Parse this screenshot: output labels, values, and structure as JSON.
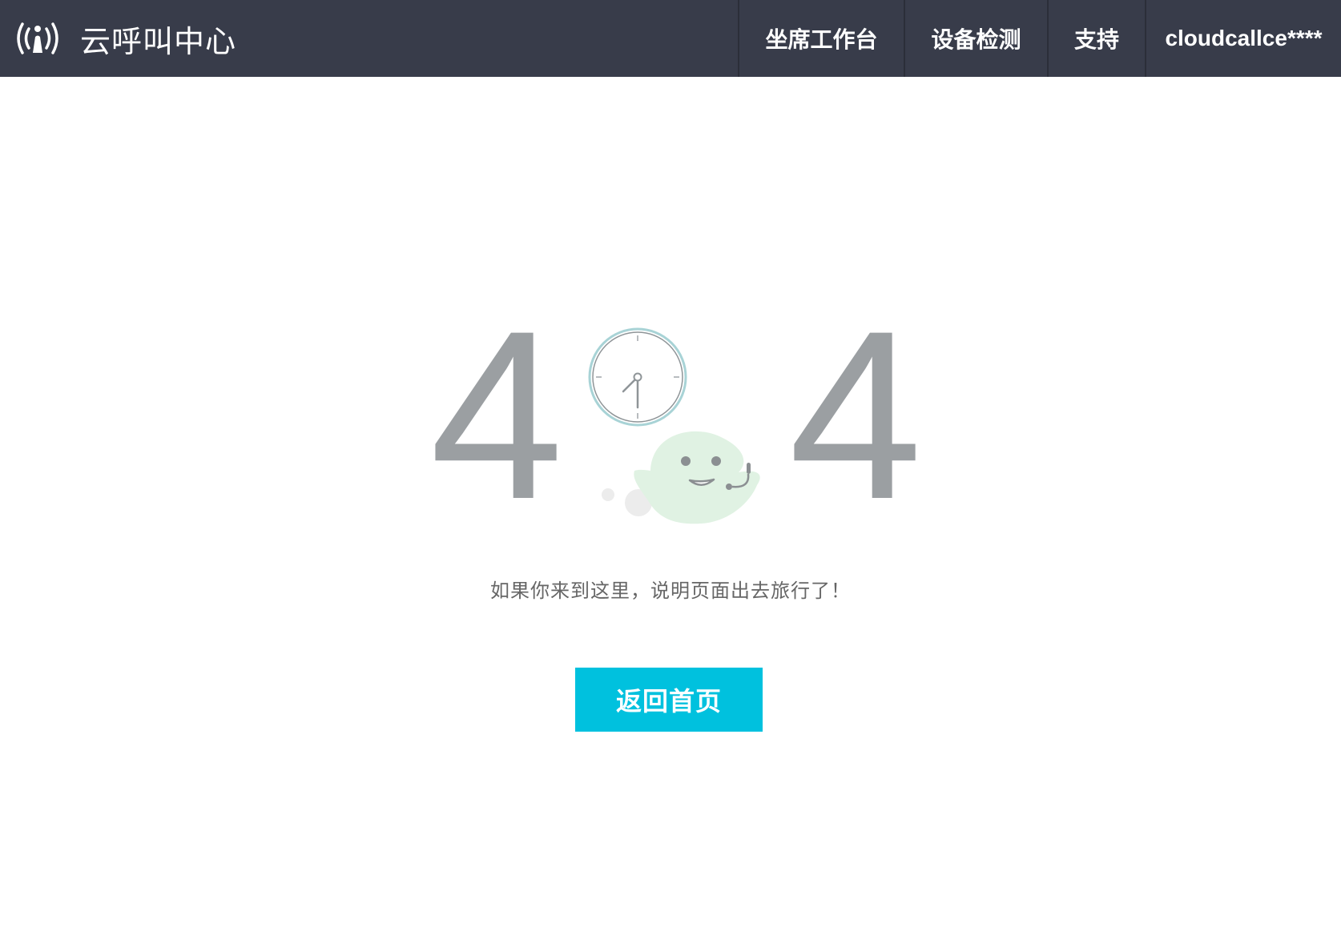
{
  "header": {
    "title": "云呼叫中心",
    "logo_icon": "broadcast-person-icon",
    "nav": [
      {
        "label": "坐席工作台"
      },
      {
        "label": "设备检测"
      },
      {
        "label": "支持"
      },
      {
        "label": "cloudcallce****"
      }
    ]
  },
  "error": {
    "code_left": "4",
    "code_right": "4",
    "clock_icon": "clock-icon",
    "mascot_icon": "smiling-bubble-headset-icon",
    "message": "如果你来到这里，说明页面出去旅行了！"
  },
  "actions": {
    "home_label": "返回首页"
  },
  "colors": {
    "header_bg": "#383c4a",
    "digit_gray": "#9b9fa2",
    "accent": "#00c1de",
    "mascot_green": "#e0f2e3",
    "clock_ring": "#a8d3d6"
  }
}
